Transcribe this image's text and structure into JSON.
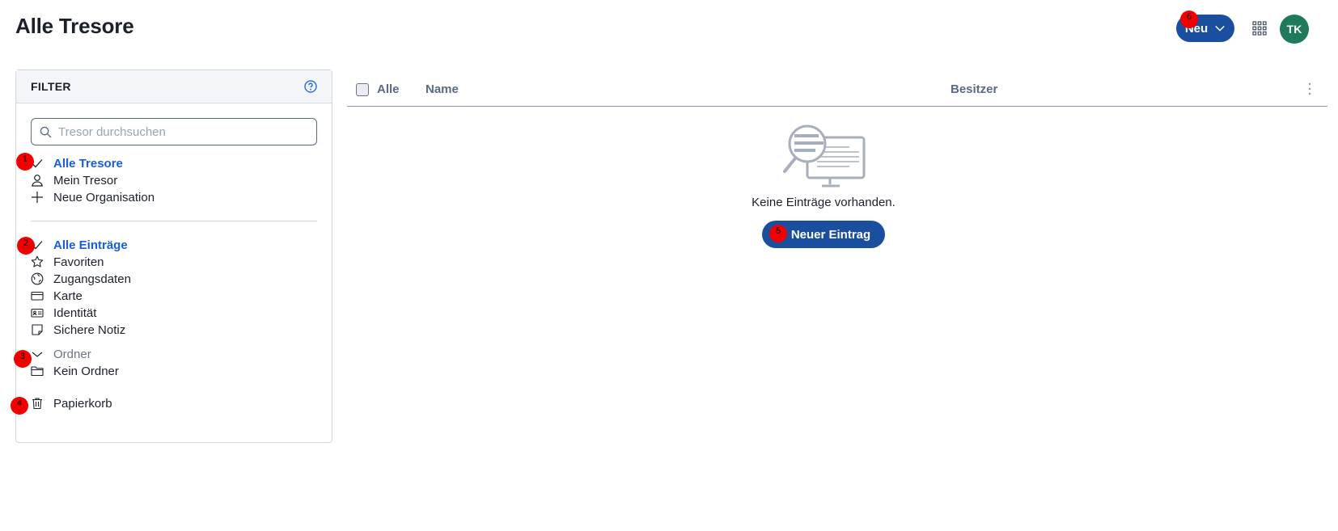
{
  "header": {
    "title": "Alle Tresore",
    "new_button_label": "Neu",
    "avatar_initials": "TK"
  },
  "filter": {
    "title": "FILTER",
    "search_placeholder": "Tresor durchsuchen",
    "vaults": [
      {
        "label": "Alle Tresore",
        "icon": "check-icon",
        "active": true
      },
      {
        "label": "Mein Tresor",
        "icon": "user-icon"
      },
      {
        "label": "Neue Organisation",
        "icon": "plus-icon"
      }
    ],
    "types": [
      {
        "label": "Alle Einträge",
        "icon": "check-icon",
        "active": true
      },
      {
        "label": "Favoriten",
        "icon": "star-icon"
      },
      {
        "label": "Zugangsdaten",
        "icon": "globe-icon"
      },
      {
        "label": "Karte",
        "icon": "credit-card-icon"
      },
      {
        "label": "Identität",
        "icon": "id-card-icon"
      },
      {
        "label": "Sichere Notiz",
        "icon": "sticky-note-icon"
      }
    ],
    "folders_label": "Ordner",
    "no_folder_label": "Kein Ordner",
    "trash_label": "Papierkorb"
  },
  "table": {
    "select_all_label": "Alle",
    "columns": [
      "Name",
      "Besitzer"
    ]
  },
  "empty_state": {
    "message": "Keine Einträge vorhanden.",
    "button_label": "Neuer Eintrag"
  },
  "badges": [
    "1",
    "2",
    "3",
    "4",
    "5",
    "6"
  ],
  "colors": {
    "accent": "#175ddc",
    "primary_button": "#1a4fa0",
    "avatar": "#1e7a5a",
    "badge": "#f00000"
  }
}
